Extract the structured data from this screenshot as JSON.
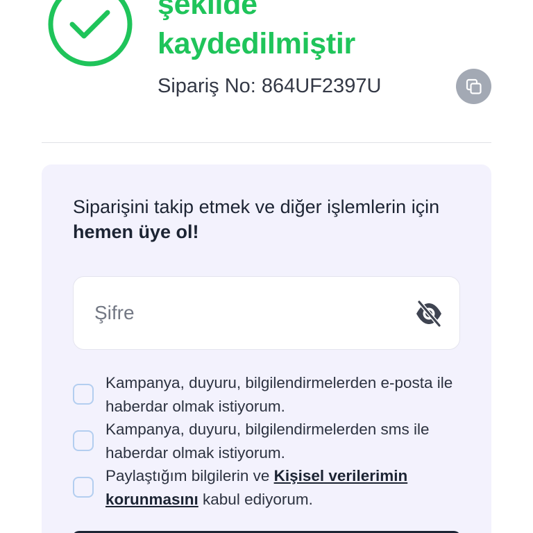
{
  "success": {
    "title_line1": "şekilde",
    "title_line2": "kaydedilmiştir",
    "order_label": "Sipariş No:",
    "order_number": "864UF2397U",
    "icon": "check-circle-icon",
    "copy_icon": "copy-icon",
    "accent_color": "#1fc45a"
  },
  "signup": {
    "text_start": "Siparişini takip etmek ve diğer işlemlerin için ",
    "text_bold": "hemen üye ol!",
    "password_placeholder": "Şifre",
    "password_value": "",
    "eye_icon": "eye-slash-icon",
    "card_color": "#f3f2fd"
  },
  "consents": [
    {
      "label": "Kampanya, duyuru, bilgilendirmelerden e-posta ile haberdar olmak istiyorum.",
      "checked": false
    },
    {
      "label": "Kampanya, duyuru, bilgilendirmelerden sms ile haberdar olmak istiyorum.",
      "checked": false
    },
    {
      "label_start": "Paylaştığım bilgilerin ve ",
      "link_text": "Kişisel verilerimin korunmasını",
      "label_end": " kabul ediyorum.",
      "checked": false
    }
  ]
}
